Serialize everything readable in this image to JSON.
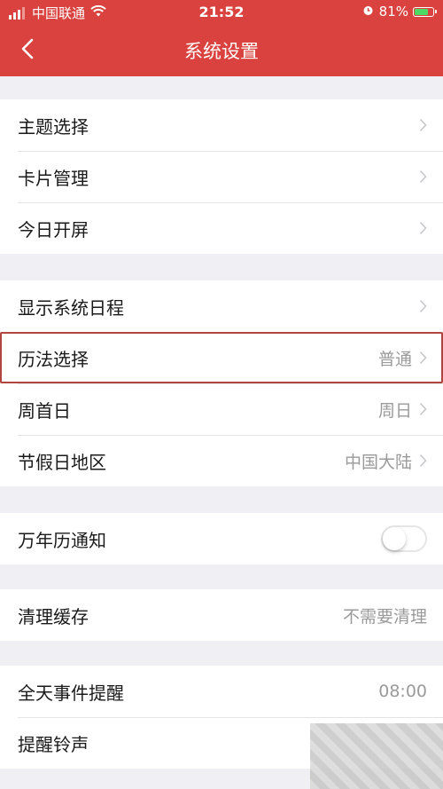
{
  "status_bar": {
    "carrier": "中国联通",
    "time": "21:52",
    "battery": "81%",
    "battery_level": 0.81,
    "icons": [
      "signal-icon",
      "wifi-icon",
      "alarm-icon",
      "battery-icon"
    ]
  },
  "nav": {
    "title": "系统设置",
    "back_icon": "back-chevron-icon"
  },
  "colors": {
    "header_bg": "#d9423e",
    "highlight_border": "#b0463e"
  },
  "groups": [
    {
      "rows": [
        {
          "label": "主题选择"
        },
        {
          "label": "卡片管理"
        },
        {
          "label": "今日开屏"
        }
      ]
    },
    {
      "rows": [
        {
          "label": "显示系统日程"
        },
        {
          "label": "历法选择",
          "value": "普通",
          "highlighted": true
        },
        {
          "label": "周首日",
          "value": "周日"
        },
        {
          "label": "节假日地区",
          "value": "中国大陆"
        }
      ]
    },
    {
      "rows": [
        {
          "label": "万年历通知",
          "toggle": false
        }
      ]
    },
    {
      "rows": [
        {
          "label": "清理缓存",
          "value": "不需要清理"
        }
      ]
    },
    {
      "rows": [
        {
          "label": "全天事件提醒",
          "value": "08:00"
        },
        {
          "label": "提醒铃声"
        }
      ]
    }
  ]
}
